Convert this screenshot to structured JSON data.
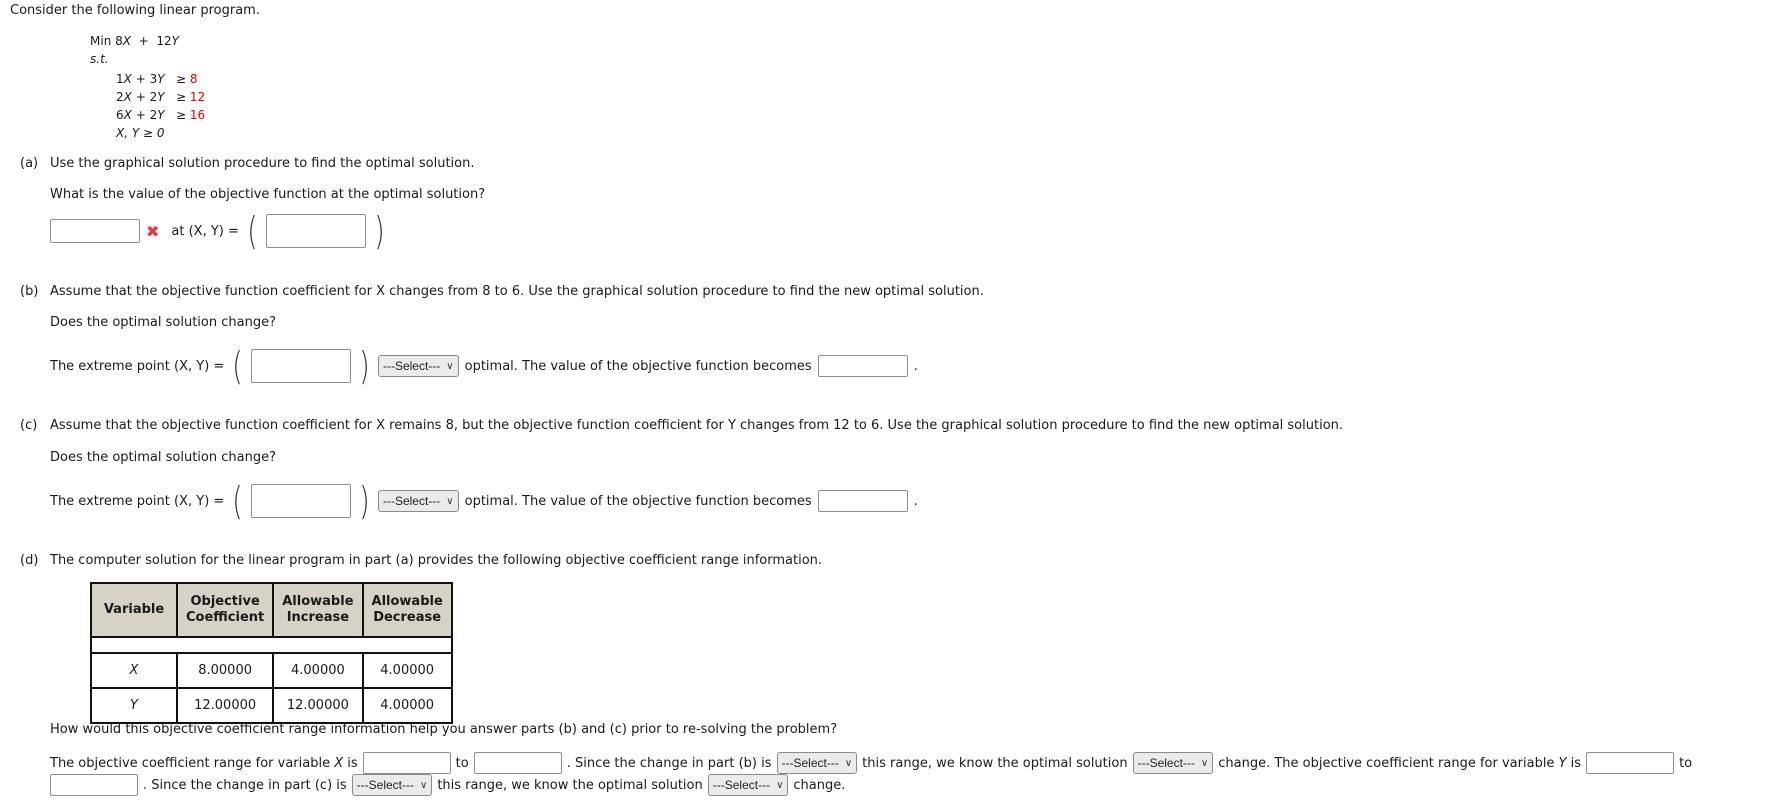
{
  "intro": "Consider the following linear program.",
  "lp": {
    "objective_prefix": "Min",
    "objective": [
      {
        "coef": "8",
        "var": "X"
      },
      {
        "op": "+"
      },
      {
        "coef": "12",
        "var": "Y"
      }
    ],
    "st": "s.t.",
    "constraints": [
      {
        "a": "1",
        "b": "3",
        "rel": "≥",
        "rhs": "8"
      },
      {
        "a": "2",
        "b": "2",
        "rel": "≥",
        "rhs": "12"
      },
      {
        "a": "6",
        "b": "2",
        "rel": "≥",
        "rhs": "16"
      }
    ],
    "nonneg": "X, Y ≥ 0"
  },
  "part_a": {
    "label": "(a)",
    "text": "Use the graphical solution procedure to find the optimal solution.",
    "question": "What is the value of the objective function at the optimal solution?",
    "objective_value": "",
    "status": "incorrect",
    "at_label": "at (X, Y) =",
    "point_value": ""
  },
  "part_b": {
    "label": "(b)",
    "text": "Assume that the objective function coefficient for X changes from 8 to 6. Use the graphical solution procedure to find the new optimal solution.",
    "question": "Does the optimal solution change?",
    "extreme_label": "The extreme point (X, Y) =",
    "point_value": "",
    "select": "---Select---",
    "after_select": "optimal. The value of the objective function becomes",
    "objective_value": "",
    "end": "."
  },
  "part_c": {
    "label": "(c)",
    "text": "Assume that the objective function coefficient for X remains 8, but the objective function coefficient for Y changes from 12 to 6. Use the graphical solution procedure to find the new optimal solution.",
    "question": "Does the optimal solution change?",
    "extreme_label": "The extreme point (X, Y) =",
    "point_value": "",
    "select": "---Select---",
    "after_select": "optimal. The value of the objective function becomes",
    "objective_value": "",
    "end": "."
  },
  "part_d": {
    "label": "(d)",
    "text": "The computer solution for the linear program in part (a) provides the following objective coefficient range information.",
    "table": {
      "headers": [
        "Variable",
        "Objective Coefficient",
        "Allowable Increase",
        "Allowable Decrease"
      ],
      "header_lines": [
        [
          "Variable"
        ],
        [
          "Objective",
          "Coefficient"
        ],
        [
          "Allowable",
          "Increase"
        ],
        [
          "Allowable",
          "Decrease"
        ]
      ],
      "rows": [
        [
          "X",
          "8.00000",
          "4.00000",
          "4.00000"
        ],
        [
          "Y",
          "12.00000",
          "12.00000",
          "4.00000"
        ]
      ]
    },
    "question": "How would this objective coefficient range information help you answer parts (b) and (c) prior to re-solving the problem?",
    "s1": "The objective coefficient range for variable",
    "var_x": "X",
    "is": "is",
    "to": "to",
    "s2": ". Since the change in part (b) is",
    "s3": "this range, we know the optimal solution",
    "s4": "change. The objective coefficient range for variable",
    "var_y": "Y",
    "s5": ". Since the change in part (c) is",
    "s6": "this range, we know the optimal solution",
    "s7": "change.",
    "select": "---Select---",
    "x_low": "",
    "x_high": "",
    "y_low": "",
    "y_high": ""
  }
}
